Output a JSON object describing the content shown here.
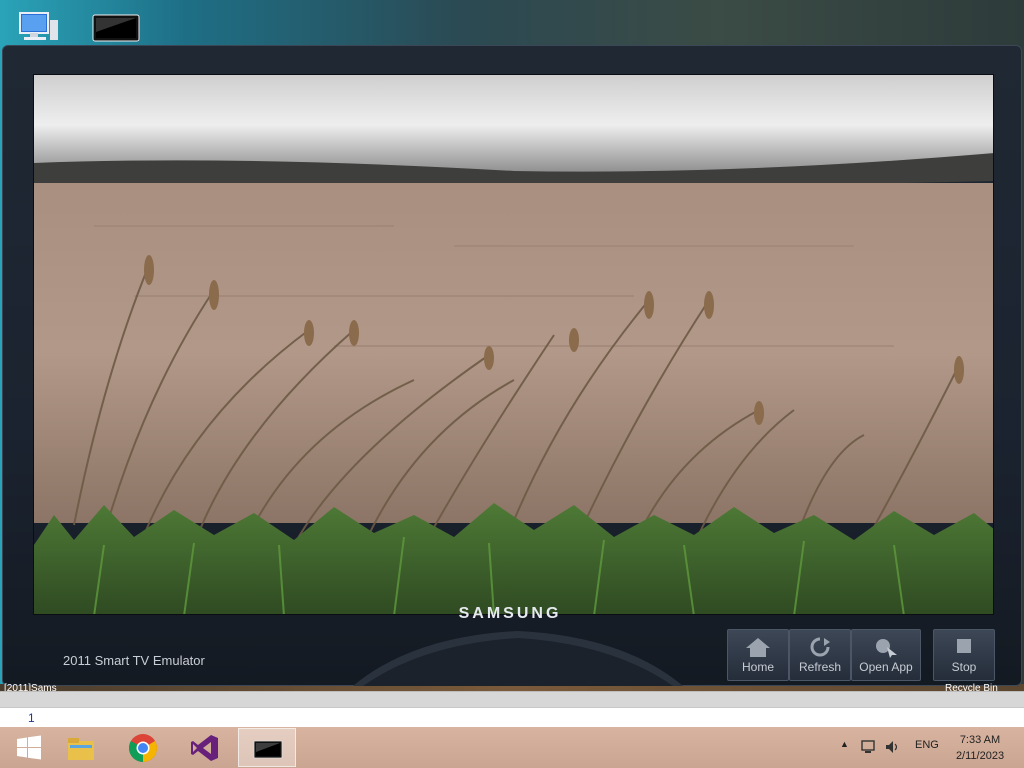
{
  "desktop": {
    "icons": [
      "computer-icon",
      "tv-emulator-shortcut-icon"
    ],
    "bottom_left_label": "[2011]Sams",
    "bottom_right_label": "Recycle Bin"
  },
  "emulator": {
    "title": "2011 Smart TV Emulator",
    "brand": "SAMSUNG",
    "controls": {
      "home": "Home",
      "refresh": "Refresh",
      "open_app": "Open App",
      "stop": "Stop"
    }
  },
  "command_line": {
    "value": "1"
  },
  "taskbar": {
    "apps": [
      "windows-start-icon",
      "file-explorer-icon",
      "chrome-icon",
      "visual-studio-icon",
      "tv-emulator-icon"
    ],
    "language": "ENG",
    "time": "7:33 AM",
    "date": "2/11/2023"
  }
}
